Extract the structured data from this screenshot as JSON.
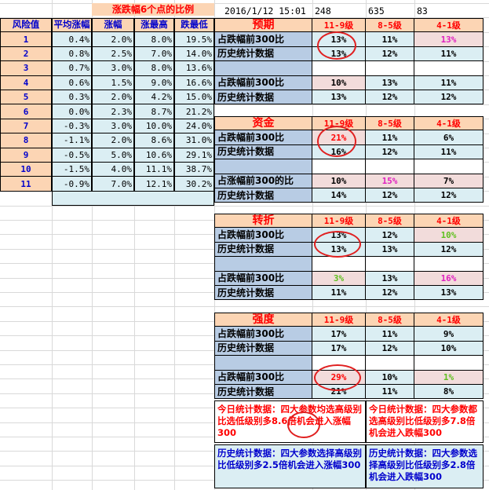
{
  "top": {
    "banner": "涨跌幅6个点的比例",
    "datetime": "2016/1/12 15:01",
    "n1": "248",
    "n2": "635",
    "n3": "83"
  },
  "left": {
    "headers": [
      "风险值",
      "平均涨幅",
      "涨幅",
      "涨最高",
      "跌最低"
    ],
    "rows": [
      [
        "1",
        "0.4%",
        "2.0%",
        "8.0%",
        "19.5%"
      ],
      [
        "2",
        "0.8%",
        "2.5%",
        "7.0%",
        "14.0%"
      ],
      [
        "3",
        "0.7%",
        "3.0%",
        "8.0%",
        "13.6%"
      ],
      [
        "4",
        "0.6%",
        "1.5%",
        "9.0%",
        "16.6%"
      ],
      [
        "5",
        "0.3%",
        "2.0%",
        "4.2%",
        "15.0%"
      ],
      [
        "6",
        "0.0%",
        "2.3%",
        "8.7%",
        "21.2%"
      ],
      [
        "7",
        "-0.3%",
        "3.0%",
        "10.0%",
        "24.0%"
      ],
      [
        "8",
        "-1.1%",
        "2.0%",
        "8.6%",
        "31.0%"
      ],
      [
        "9",
        "-0.5%",
        "5.0%",
        "10.6%",
        "29.1%"
      ],
      [
        "10",
        "-1.5%",
        "4.0%",
        "11.1%",
        "38.7%"
      ],
      [
        "11",
        "-0.9%",
        "7.0%",
        "12.1%",
        "30.2%"
      ]
    ]
  },
  "levels": [
    "11-9级",
    "8-5级",
    "4-1级"
  ],
  "sections": [
    {
      "title": "预期",
      "rows": [
        {
          "label": "占跌幅前300比",
          "v": [
            "13%",
            "11%",
            "13%"
          ]
        },
        {
          "label": "历史统计数据",
          "v": [
            "13%",
            "12%",
            "11%"
          ]
        },
        {
          "label": "",
          "v": [
            "",
            "",
            ""
          ]
        },
        {
          "label": "占跌幅前300比",
          "v": [
            "10%",
            "13%",
            "11%"
          ]
        },
        {
          "label": "历史统计数据",
          "v": [
            "13%",
            "12%",
            "12%"
          ]
        }
      ]
    },
    {
      "title": "资金",
      "rows": [
        {
          "label": "占跌幅前300比",
          "v": [
            "21%",
            "11%",
            "6%"
          ]
        },
        {
          "label": "历史统计数据",
          "v": [
            "16%",
            "12%",
            "11%"
          ]
        },
        {
          "label": "",
          "v": [
            "",
            "",
            ""
          ]
        },
        {
          "label": "占涨幅前300的比",
          "v": [
            "10%",
            "15%",
            "7%"
          ]
        },
        {
          "label": "历史统计数据",
          "v": [
            "14%",
            "12%",
            "12%"
          ]
        }
      ]
    },
    {
      "title": "转折",
      "rows": [
        {
          "label": "占跌幅前300比",
          "v": [
            "13%",
            "12%",
            "10%"
          ]
        },
        {
          "label": "历史统计数据",
          "v": [
            "13%",
            "13%",
            "12%"
          ]
        },
        {
          "label": "",
          "v": [
            "",
            "",
            ""
          ]
        },
        {
          "label": "占跌幅前300比",
          "v": [
            "3%",
            "13%",
            "16%"
          ]
        },
        {
          "label": "历史统计数据",
          "v": [
            "11%",
            "12%",
            "13%"
          ]
        }
      ]
    },
    {
      "title": "强度",
      "rows": [
        {
          "label": "占跌幅前300比",
          "v": [
            "17%",
            "11%",
            "9%"
          ]
        },
        {
          "label": "历史统计数据",
          "v": [
            "17%",
            "12%",
            "10%"
          ]
        },
        {
          "label": "",
          "v": [
            "",
            "",
            ""
          ]
        },
        {
          "label": "占跌幅前300比",
          "v": [
            "29%",
            "10%",
            "1%"
          ]
        },
        {
          "label": "历史统计数据",
          "v": [
            "21%",
            "11%",
            "8%"
          ]
        }
      ]
    }
  ],
  "notes": {
    "today_left": "今日统计数据：四大参数均选高级别比选低级别多8.6倍机会进入涨幅300",
    "today_right": "今日统计数据：四大参数都选高级别比低级别多7.8倍机会进入跌幅300",
    "hist_left": "历史统计数据：四大参数选择高级别比低级别多2.5倍机会进入涨幅300",
    "hist_right": "历史统计数据：四大参数选择高级别比低级别多2.8倍机会进入跌幅300"
  },
  "colors": {
    "left_header_bg": "#fcd5b4",
    "left_data_bg": "#dbeef3",
    "left_first_col_bg": "#fcd5b4",
    "banner_bg": "#fcd5b4",
    "title_bg": "#fcd5b4",
    "label_bg": "#b8cce4",
    "data_bg": "#dbeef3",
    "highlight_bg": "#f2dcdb",
    "red": "#ff0000",
    "magenta": "#e020c0",
    "green": "#60c020",
    "blue_text": "#0000cc"
  }
}
